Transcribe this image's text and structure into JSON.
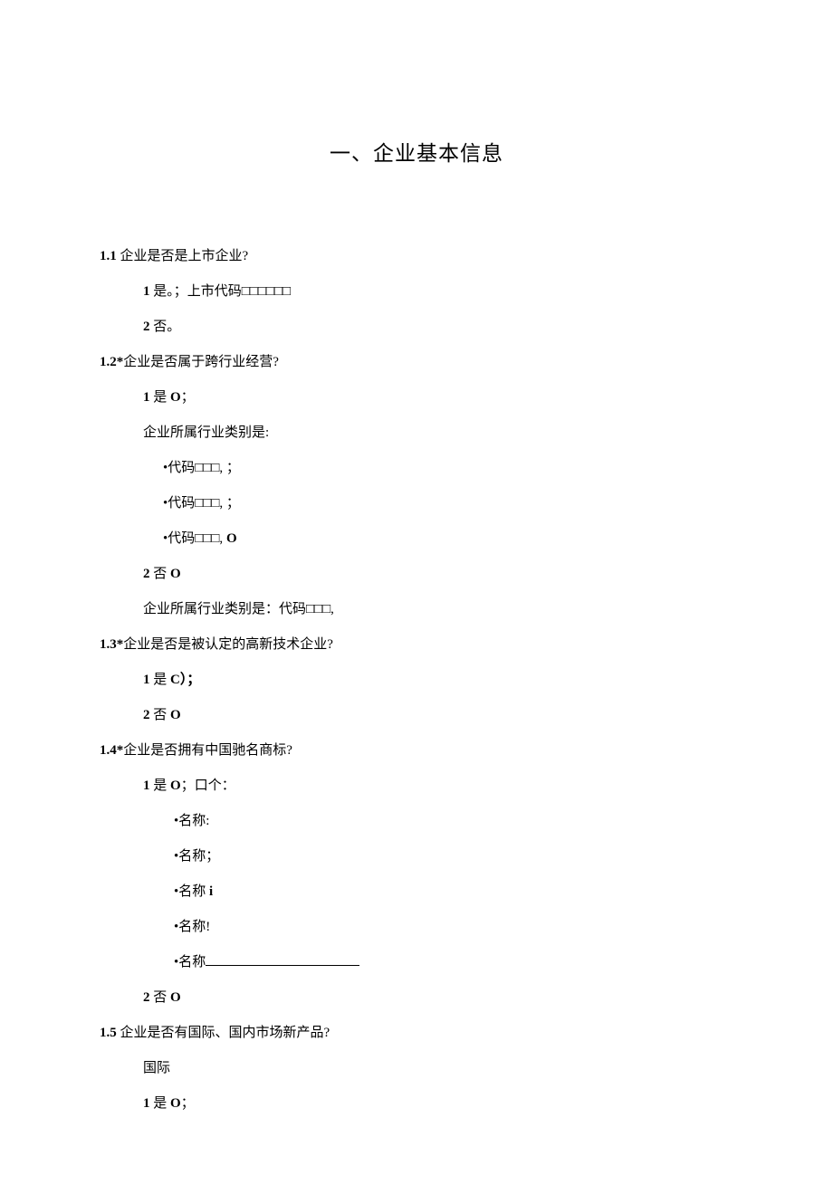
{
  "title": "一、企业基本信息",
  "q1_1": {
    "num": "1.1",
    "text": " 企业是否是上市企业?",
    "opt1_num": "1",
    "opt1_text": " 是。；上市代码□□□□□□",
    "opt2_num": "2",
    "opt2_text": " 否。"
  },
  "q1_2": {
    "num": "1.2*",
    "text": "企业是否属于跨行业经营?",
    "opt1_num": "1",
    "opt1_text": " 是 ",
    "opt1_tail": "O",
    "opt1_tail2": "；",
    "sub_text": "企业所属行业类别是:",
    "code1": "•代码□□□, ；",
    "code2": "•代码□□□, ；",
    "code3a": "•代码□□□, ",
    "code3b": "O",
    "opt2_num": "2",
    "opt2_text": " 否 ",
    "opt2_tail": "O",
    "sub2_text": "企业所属行业类别是：代码□□□,"
  },
  "q1_3": {
    "num": "1.3*",
    "text": "企业是否是被认定的高新技术企业?",
    "opt1_num": "1",
    "opt1_text": " 是 ",
    "opt1_tail": "C）；",
    "opt2_num": "2",
    "opt2_text": " 否 ",
    "opt2_tail": "O"
  },
  "q1_4": {
    "num": "1.4*",
    "text": "企业是否拥有中国驰名商标?",
    "opt1_num": "1",
    "opt1_text": " 是 ",
    "opt1_tail": "O",
    "opt1_tail2": "；口个：",
    "name1": "•名称:",
    "name2": "•名称；",
    "name3": "•名称 ",
    "name3b": "i",
    "name4": "•名称!",
    "name5": "•名称",
    "opt2_num": "2",
    "opt2_text": " 否 ",
    "opt2_tail": "O"
  },
  "q1_5": {
    "num": "1.5",
    "text": " 企业是否有国际、国内市场新产品?",
    "sub_text": "国际",
    "opt1_num": "1",
    "opt1_text": " 是 ",
    "opt1_tail": "O",
    "opt1_tail2": "；"
  }
}
